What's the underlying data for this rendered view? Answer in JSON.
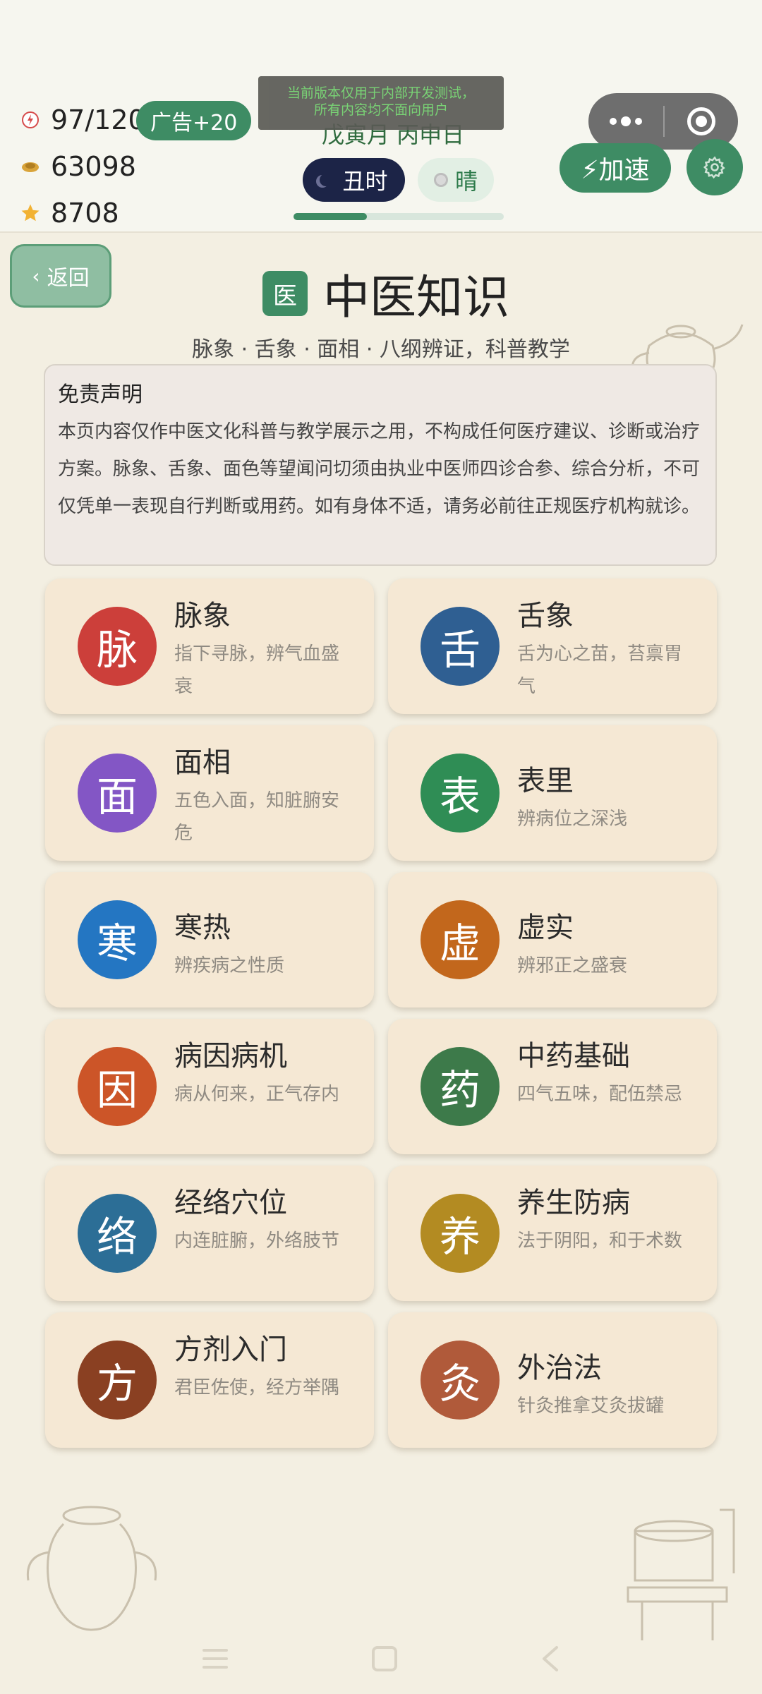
{
  "status": {
    "energy": "97/120",
    "ad_button": "广告+20",
    "coins": "63098",
    "stars": "8708"
  },
  "dev_banner": [
    "当前版本仅用于内部开发测试，",
    "所有内容均不面向用户"
  ],
  "calendar": {
    "date": "戊寅月 丙申日",
    "hour": "丑时",
    "weather": "晴",
    "progress": 0.35
  },
  "controls": {
    "speed": "⚡加速"
  },
  "nav": {
    "back": "返回"
  },
  "page": {
    "badge": "医",
    "title": "中医知识",
    "subtitle": "脉象 · 舌象 · 面相 · 八纲辨证，科普教学"
  },
  "disclaimer": {
    "heading": "免责声明",
    "body": "本页内容仅作中医文化科普与教学展示之用，不构成任何医疗建议、诊断或治疗方案。脉象、舌象、面色等望闻问切须由执业中医师四诊合参、综合分析，不可仅凭单一表现自行判断或用药。如有身体不适，请务必前往正规医疗机构就诊。"
  },
  "cards": [
    {
      "glyph": "脉",
      "name": "脉象",
      "desc": "指下寻脉，辨气血盛衰",
      "color": "#cc3f3a"
    },
    {
      "glyph": "舌",
      "name": "舌象",
      "desc": "舌为心之苗，苔禀胃气",
      "color": "#2f5f92"
    },
    {
      "glyph": "面",
      "name": "面相",
      "desc": "五色入面，知脏腑安危",
      "color": "#8356c5"
    },
    {
      "glyph": "表",
      "name": "表里",
      "desc": "辨病位之深浅",
      "color": "#2f8d55"
    },
    {
      "glyph": "寒",
      "name": "寒热",
      "desc": "辨疾病之性质",
      "color": "#2476c2"
    },
    {
      "glyph": "虚",
      "name": "虚实",
      "desc": "辨邪正之盛衰",
      "color": "#c2671c"
    },
    {
      "glyph": "因",
      "name": "病因病机",
      "desc": "病从何来，正气存内",
      "color": "#cc5528"
    },
    {
      "glyph": "药",
      "name": "中药基础",
      "desc": "四气五味，配伍禁忌",
      "color": "#3d7a4a"
    },
    {
      "glyph": "络",
      "name": "经络穴位",
      "desc": "内连脏腑，外络肢节",
      "color": "#2c6e96"
    },
    {
      "glyph": "养",
      "name": "养生防病",
      "desc": "法于阴阳，和于术数",
      "color": "#b38b22"
    },
    {
      "glyph": "方",
      "name": "方剂入门",
      "desc": "君臣佐使，经方举隅",
      "color": "#8a4022"
    },
    {
      "glyph": "灸",
      "name": "外治法",
      "desc": "针灸推拿艾灸拔罐",
      "color": "#b05a3a"
    }
  ]
}
